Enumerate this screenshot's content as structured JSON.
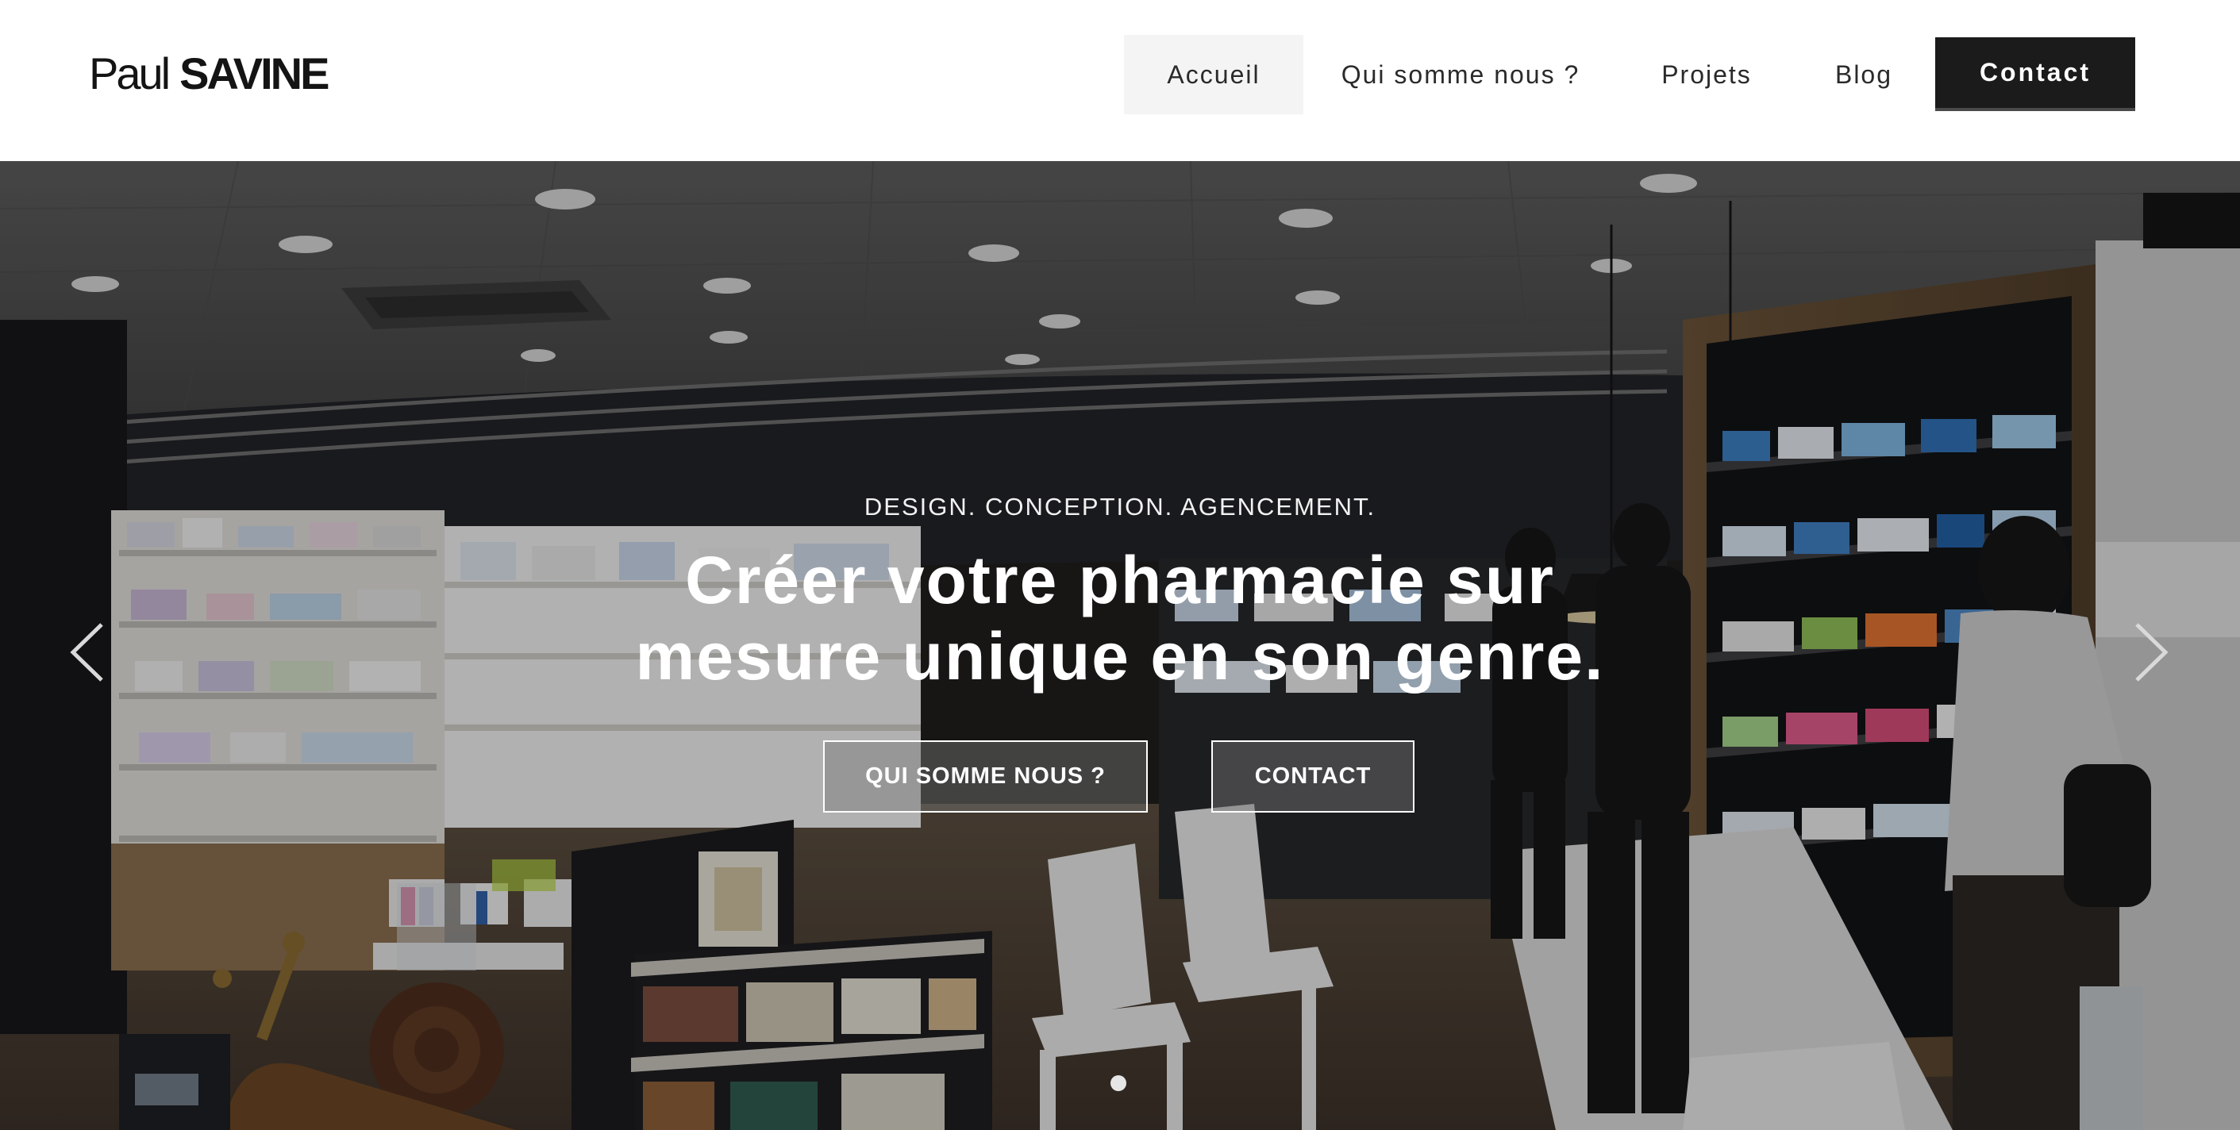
{
  "header": {
    "logo_first": "Paul",
    "logo_last": "SAVINE",
    "nav": [
      {
        "label": "Accueil",
        "active": true
      },
      {
        "label": "Qui somme nous ?"
      },
      {
        "label": "Projets"
      },
      {
        "label": "Blog"
      }
    ],
    "contact_label": "Contact"
  },
  "hero": {
    "kicker": "DESIGN. CONCEPTION. AGENCEMENT.",
    "title_line1": "Créer votre pharmacie sur",
    "title_line2": "mesure unique en son genre.",
    "buttons": [
      "QUI SOMME NOUS ?",
      "CONTACT"
    ],
    "arrows": [
      "chevron-left-icon",
      "chevron-right-icon"
    ],
    "slide_indicator": {
      "count": 1,
      "active": 1
    }
  },
  "colors": {
    "header_bg": "#ffffff",
    "nav_active_bg": "#f4f4f4",
    "contact_bg": "#1b1b1b",
    "text_dark": "#141414",
    "hero_text": "#ffffff"
  }
}
